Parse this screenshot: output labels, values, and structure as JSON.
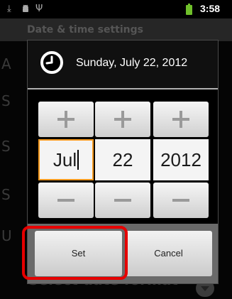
{
  "status_bar": {
    "time": "3:58",
    "icons": [
      "usb-icon",
      "android-debug-icon",
      "usb-tethering-icon",
      "battery-icon"
    ]
  },
  "settings": {
    "title": "Date & time settings",
    "footer_item": "Select date format"
  },
  "dialog": {
    "title": "Sunday, July 22, 2012",
    "month": "Jul",
    "day": "22",
    "year": "2012",
    "set_label": "Set",
    "cancel_label": "Cancel"
  },
  "colors": {
    "focus_border": "#f79a1f",
    "highlight": "#e60000",
    "battery": "#6fbf2a"
  }
}
